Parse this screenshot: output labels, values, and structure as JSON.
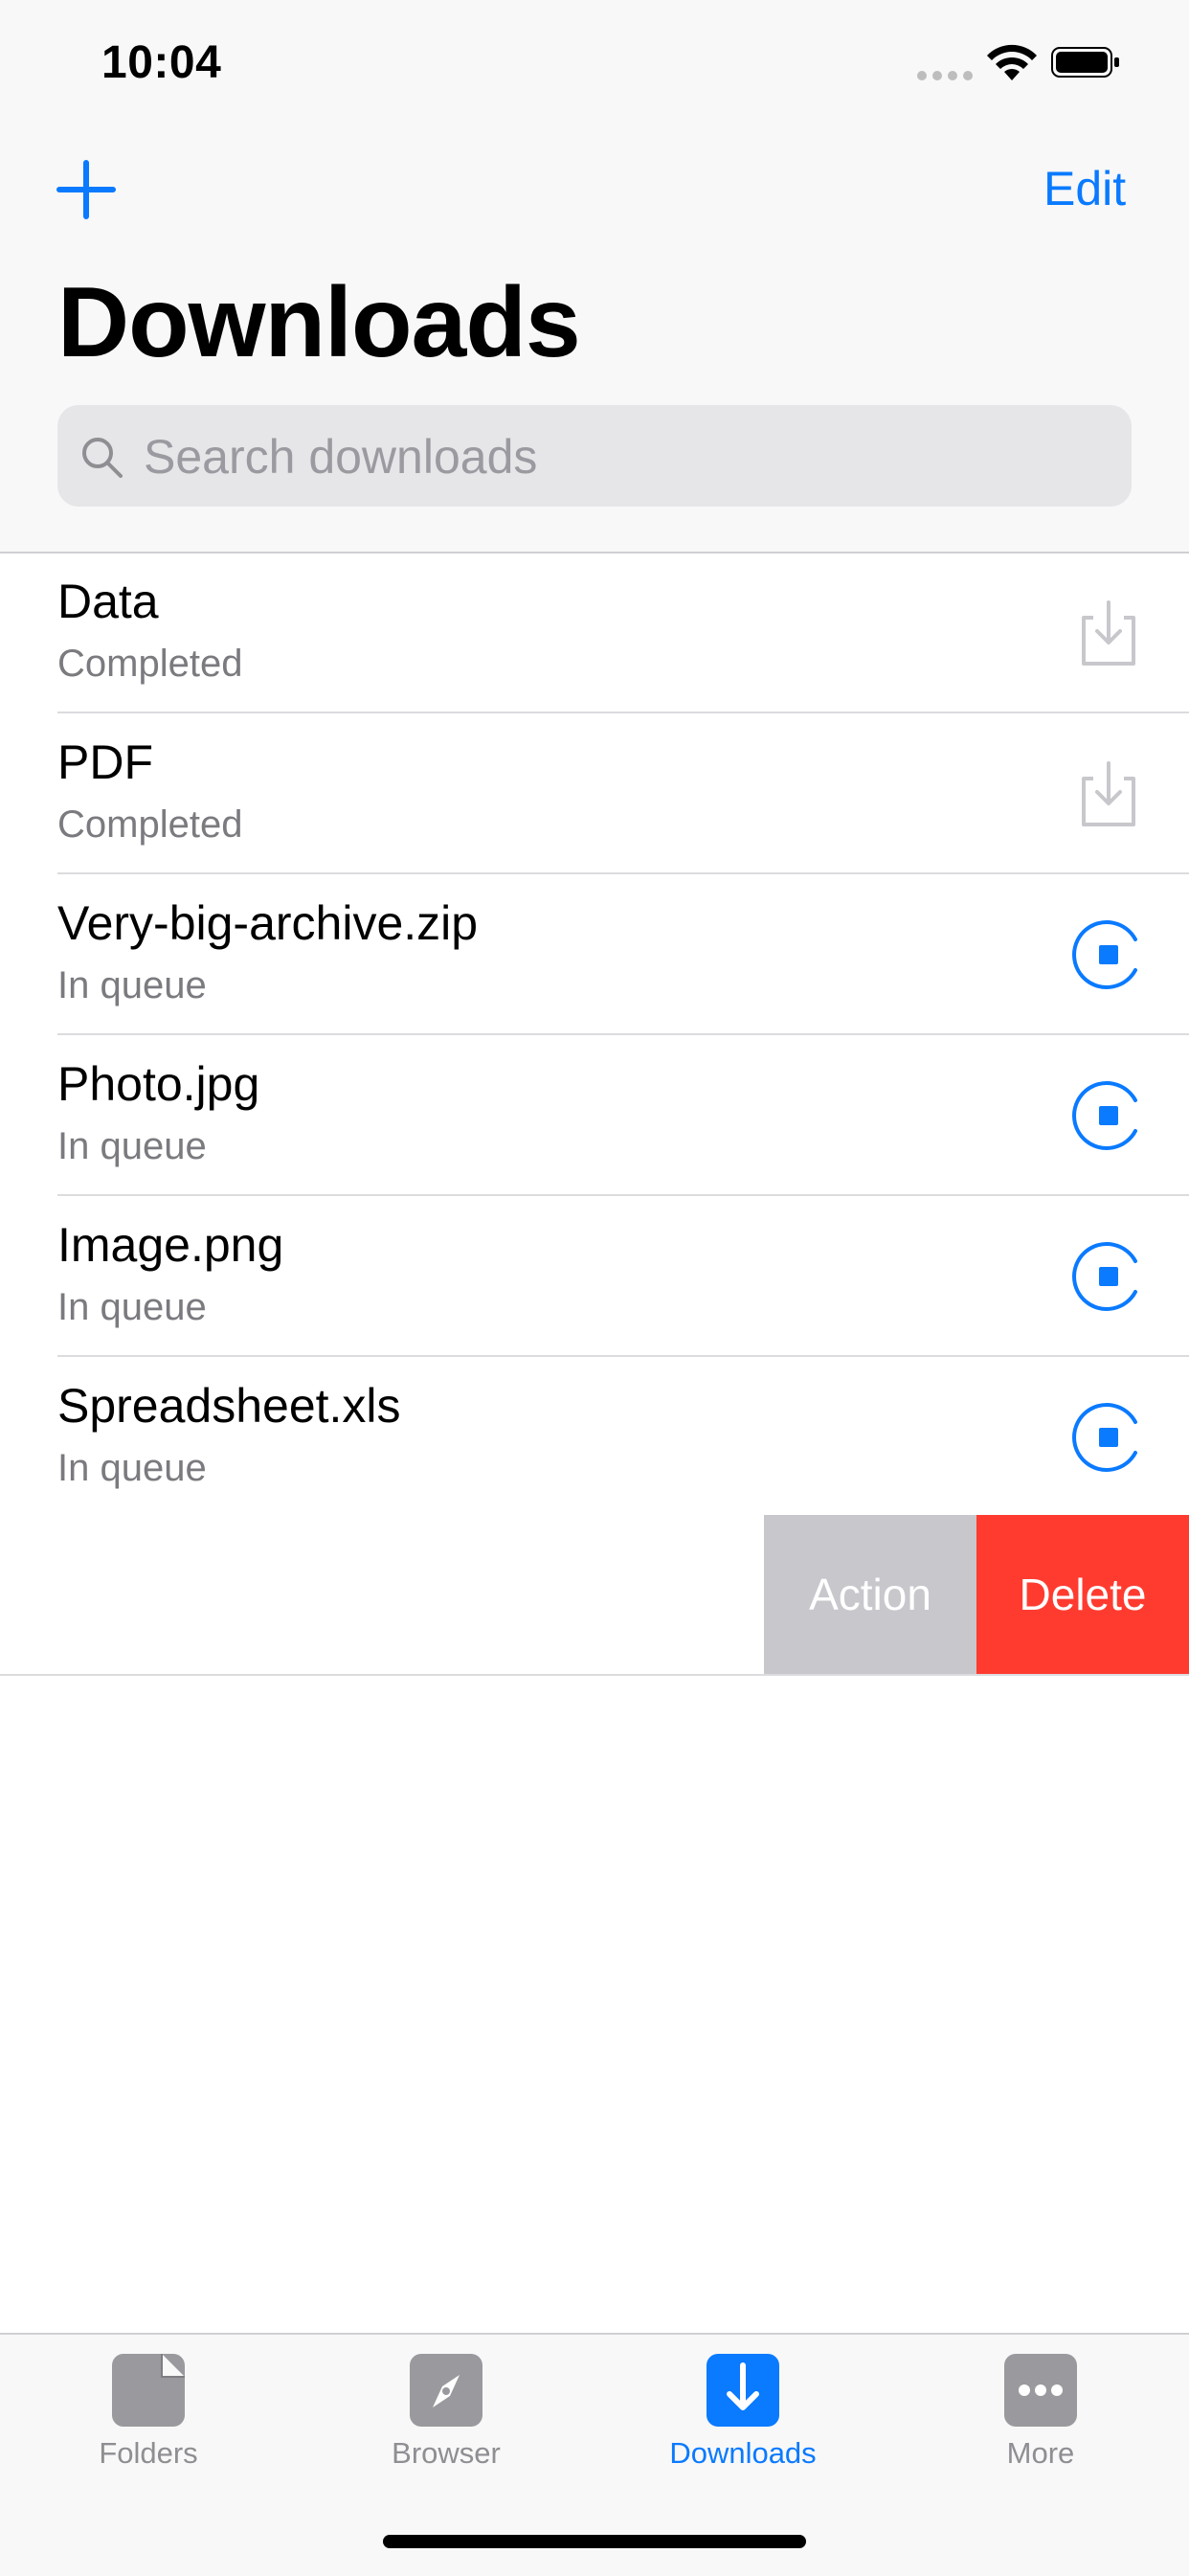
{
  "status_bar": {
    "time": "10:04"
  },
  "nav": {
    "edit_label": "Edit",
    "title": "Downloads"
  },
  "search": {
    "placeholder": "Search downloads",
    "value": ""
  },
  "downloads": [
    {
      "title": "Data",
      "status": "Completed",
      "icon": "download-box-icon"
    },
    {
      "title": "PDF",
      "status": "Completed",
      "icon": "download-box-icon"
    },
    {
      "title": "Very-big-archive.zip",
      "status": "In queue",
      "icon": "stop-progress-icon"
    },
    {
      "title": "Photo.jpg",
      "status": "In queue",
      "icon": "stop-progress-icon"
    },
    {
      "title": "Image.png",
      "status": "In queue",
      "icon": "stop-progress-icon"
    },
    {
      "title": "Spreadsheet.xls",
      "status": "In queue",
      "icon": "stop-progress-icon"
    }
  ],
  "swipe_actions": {
    "action_label": "Action",
    "delete_label": "Delete",
    "delete_color": "#ff3b30",
    "action_color": "#c7c7cc"
  },
  "tabbar": {
    "tabs": [
      {
        "label": "Folders",
        "icon": "folder-icon",
        "active": false
      },
      {
        "label": "Browser",
        "icon": "compass-icon",
        "active": false
      },
      {
        "label": "Downloads",
        "icon": "download-arrow-icon",
        "active": true
      },
      {
        "label": "More",
        "icon": "more-dots-icon",
        "active": false
      }
    ]
  },
  "colors": {
    "accent": "#0a7aff"
  }
}
